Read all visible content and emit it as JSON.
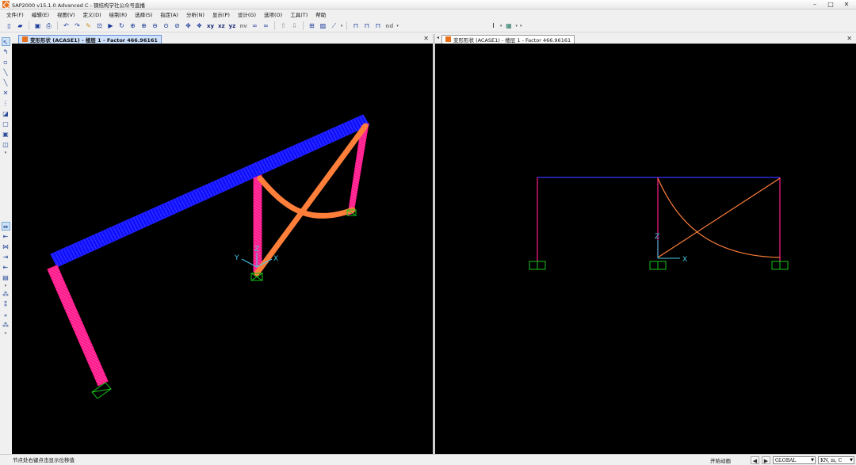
{
  "window": {
    "title": "SAP2000 v15.1.0 Advanced C  - 钢结构学社公众号直播",
    "controls": [
      "–",
      "□",
      "✕"
    ]
  },
  "menu": [
    "文件(F)",
    "编辑(E)",
    "视图(V)",
    "定义(D)",
    "绘制(R)",
    "选择(S)",
    "指定(A)",
    "分析(N)",
    "显示(P)",
    "设计(G)",
    "选项(O)",
    "工具(T)",
    "帮助"
  ],
  "toolbar": {
    "view_xy": "xy",
    "view_xz": "xz",
    "view_yz": "yz",
    "view_nv": "nv",
    "nd_label": "nd"
  },
  "panes": {
    "left": {
      "tab_label": "变形形状 (ACASE1) - 楼层 1 - Factor 466.96161",
      "active": true
    },
    "right": {
      "tab_label": "变形形状 (ACASE1) - 楼层 1 - Factor 466.96161",
      "active": false
    }
  },
  "axes": {
    "x": "X",
    "y": "Y",
    "z": "Z"
  },
  "status": {
    "message": "节点处右键点击显示位移值",
    "animation": "开始动画",
    "coord_system": "GLOBAL",
    "units": "KN, m, C"
  },
  "colors": {
    "beam": "#1010ff",
    "column": "#ff1a8c",
    "brace": "#ff7f3a",
    "support": "#16c416",
    "axis": "#44c8e8",
    "right_beam": "#3434ff"
  }
}
